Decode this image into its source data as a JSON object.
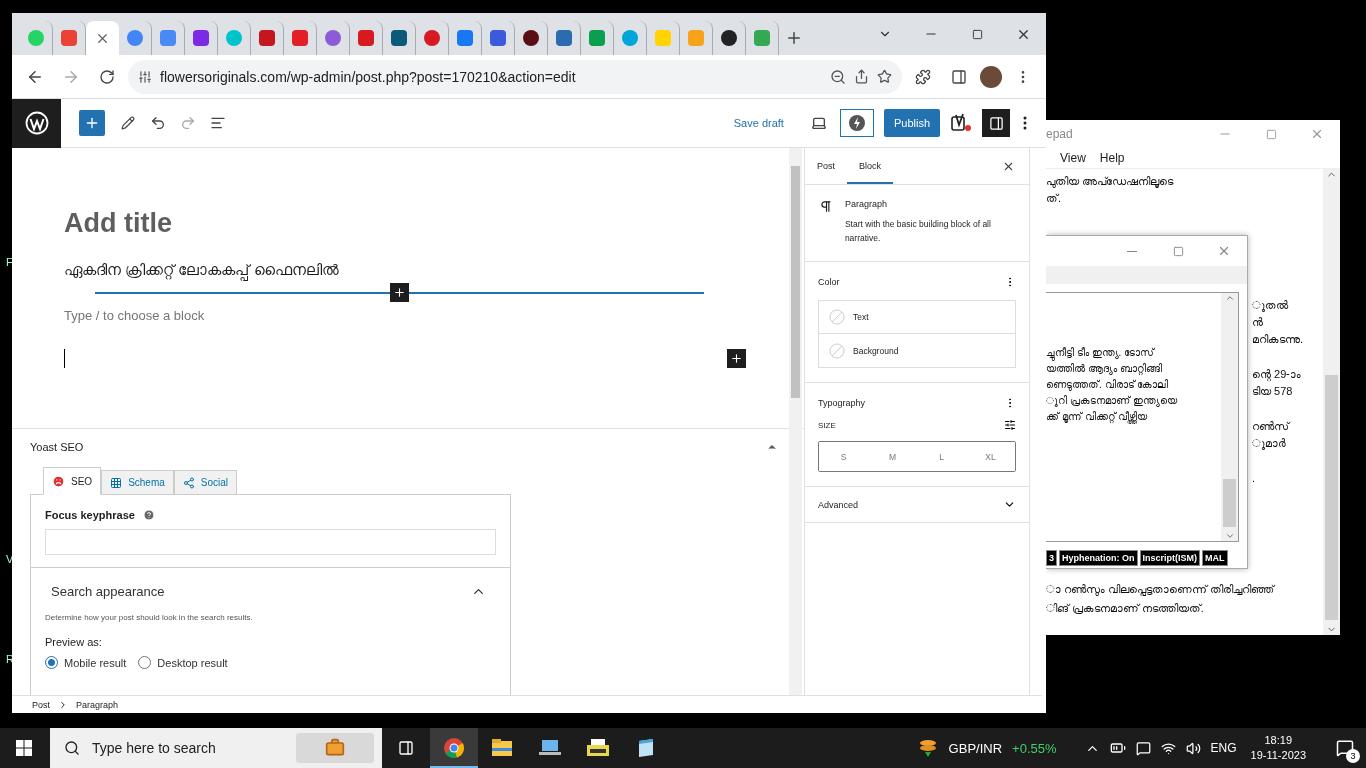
{
  "desktop": {
    "edge_labels": [
      "F",
      "V",
      "R"
    ]
  },
  "browser": {
    "tabs": [
      {
        "color": "#25d366",
        "selected": false
      },
      {
        "color": "#ea4335",
        "selected": false
      },
      {
        "color": "#5f6368",
        "selected": true
      },
      {
        "color": "#4285f4",
        "selected": false
      },
      {
        "color": "#4a8af4",
        "selected": false
      },
      {
        "color": "#7d2ae8",
        "selected": false
      },
      {
        "color": "#00c4cc",
        "selected": false
      },
      {
        "color": "#c4161c",
        "selected": false
      },
      {
        "color": "#e31e24",
        "selected": false
      },
      {
        "color": "#8e5bd6",
        "selected": false
      },
      {
        "color": "#d71920",
        "selected": false
      },
      {
        "color": "#0b5a7a",
        "selected": false
      },
      {
        "color": "#d71921",
        "selected": false
      },
      {
        "color": "#1877f2",
        "selected": false
      },
      {
        "color": "#3b5bdb",
        "selected": false
      },
      {
        "color": "#5a0f14",
        "selected": false
      },
      {
        "color": "#2b6cb0",
        "selected": false
      },
      {
        "color": "#0a9e4f",
        "selected": false
      },
      {
        "color": "#00a5d9",
        "selected": false
      },
      {
        "color": "#ffd400",
        "selected": false
      },
      {
        "color": "#f7a21b",
        "selected": false
      },
      {
        "color": "#222222",
        "selected": false
      },
      {
        "color": "#34a853",
        "selected": false
      }
    ],
    "address": "flowersoriginals.com/wp-admin/post.php?post=170210&action=edit",
    "wp": {
      "save_draft": "Save draft",
      "publish": "Publish",
      "editor": {
        "title_placeholder": "Add title",
        "paragraph": "ഏകദിന ക്രിക്കറ്റ് ലോകകപ്പ് ഫൈനലിൽ",
        "block_placeholder": "Type / to choose a block"
      },
      "yoast": {
        "heading": "Yoast SEO",
        "tabs": [
          {
            "label": "SEO",
            "selected": true,
            "kind": "seo"
          },
          {
            "label": "Schema",
            "selected": false,
            "kind": "schema"
          },
          {
            "label": "Social",
            "selected": false,
            "kind": "social"
          }
        ],
        "focus_label": "Focus keyphrase",
        "search_appearance": "Search appearance",
        "description": "Determine how your post should look in the search results.",
        "preview_label": "Preview as:",
        "preview_options": [
          {
            "label": "Mobile result",
            "selected": true
          },
          {
            "label": "Desktop result",
            "selected": false
          }
        ]
      },
      "breadcrumb": [
        "Post",
        "Paragraph"
      ],
      "sidebar": {
        "tabs": [
          {
            "label": "Post",
            "selected": false
          },
          {
            "label": "Block",
            "selected": true
          }
        ],
        "block_name": "Paragraph",
        "block_description": "Start with the basic building block of all narrative.",
        "color_heading": "Color",
        "color_items": [
          "Text",
          "Background"
        ],
        "typography_heading": "Typography",
        "size_label": "SIZE",
        "sizes": [
          {
            "label": "S",
            "selected": false
          },
          {
            "label": "M",
            "selected": false
          },
          {
            "label": "L",
            "selected": false
          },
          {
            "label": "XL",
            "selected": false
          }
        ],
        "advanced": "Advanced"
      }
    }
  },
  "notepad_back": {
    "title": "epad",
    "menu": [
      "View",
      "Help"
    ],
    "lines_top": [
      "പുതിയ അപ്ഡേഷനിലൂടെ",
      "ത്."
    ],
    "right_paragraphs": [
      [
        "ുതൽ",
        "ൻ",
        "മറികടന്നു."
      ],
      [
        "ന്റെ 29-ാം",
        "ടിയ 578"
      ],
      [
        "റൺസ്",
        "ുമാർ"
      ],
      [
        "."
      ]
    ],
    "lines_bottom": [
      "ാ റൺസും വിലപ്പെട്ടതാണെന്ന് തിരിച്ചറിഞ്ഞ്",
      "ിങ് പ്രകടനമാണ് നടത്തിയത്."
    ]
  },
  "notepad_front": {
    "lines": [
      "ച്ചുനീട്ടി ടീം ഇന്ത്യ. ടോസ്",
      "യത്തിൽ ആദ്യം ബാറ്റിങ്ങി",
      "ണെടുത്തത്. വിരാട് കോലി",
      "ുറി പ്രകടനമാണ് ഇന്ത്യയെ",
      "ക്ക് മൂന്ന് വിക്കറ്റ് വീഴ്ത്തിയ"
    ],
    "status": [
      "3",
      "Hyphenation: On",
      "Inscript(ISM)",
      "MAL"
    ]
  },
  "taskbar": {
    "search_placeholder": "Type here to search",
    "apps": [
      {
        "kind": "chrome",
        "selected": true
      },
      {
        "kind": "folder",
        "selected": false
      },
      {
        "kind": "laptop",
        "selected": false
      },
      {
        "kind": "typewriter",
        "selected": false
      },
      {
        "kind": "notepad",
        "selected": false
      }
    ],
    "ticker": {
      "pair": "GBP/INR",
      "change": "+0.55%"
    },
    "language": "ENG",
    "time": "18:19",
    "date": "19-11-2023",
    "notifications": "3"
  }
}
